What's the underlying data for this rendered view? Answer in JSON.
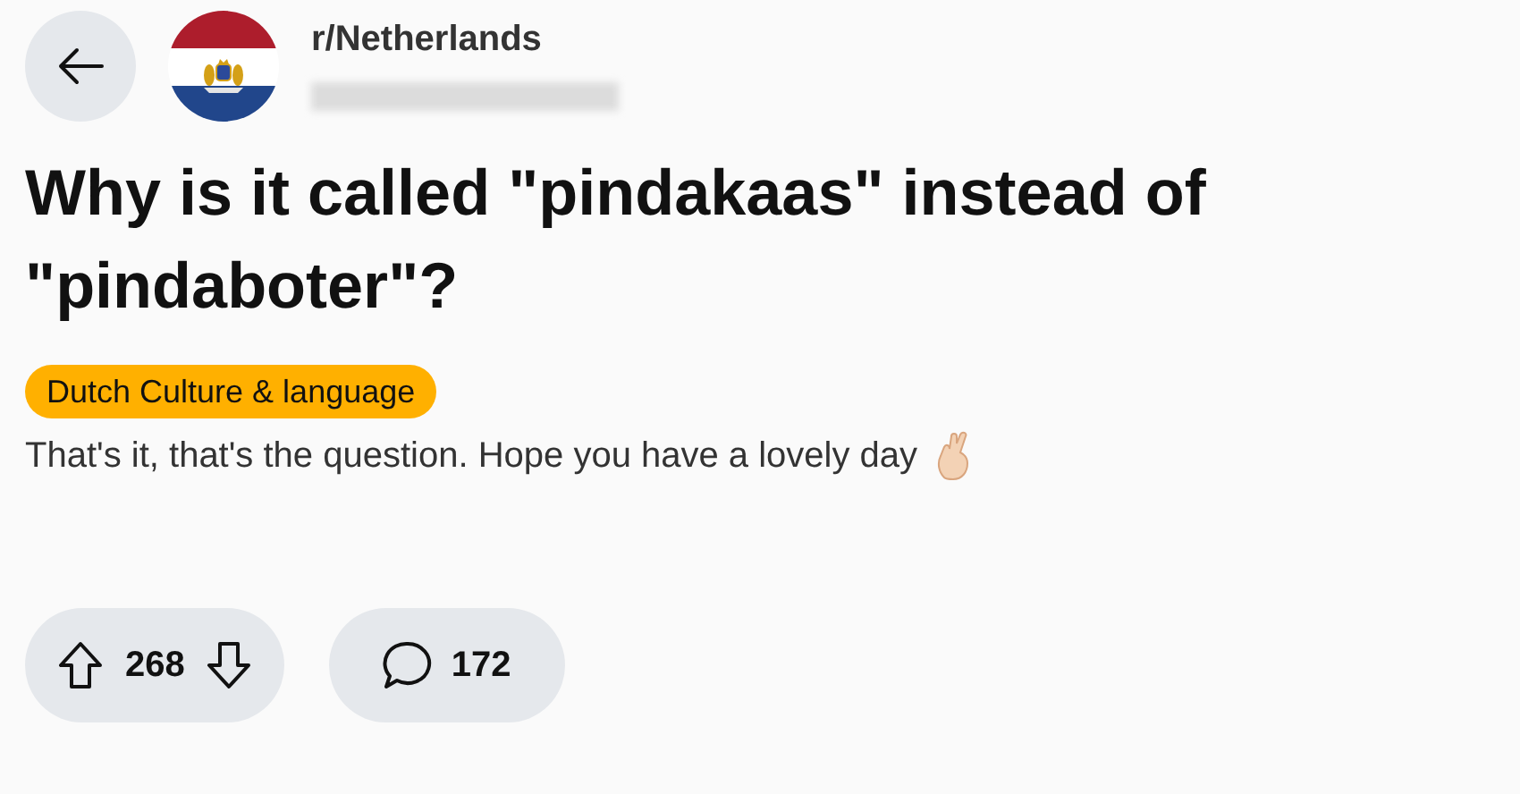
{
  "header": {
    "subreddit": "r/Netherlands"
  },
  "post": {
    "title": "Why is it called \"pindakaas\" instead of \"pindaboter\"?",
    "flair": {
      "label": "Dutch Culture & language",
      "color": "#ffb000"
    },
    "body": "That's it, that's the question. Hope you have a lovely day"
  },
  "actions": {
    "score": "268",
    "comments": "172"
  }
}
